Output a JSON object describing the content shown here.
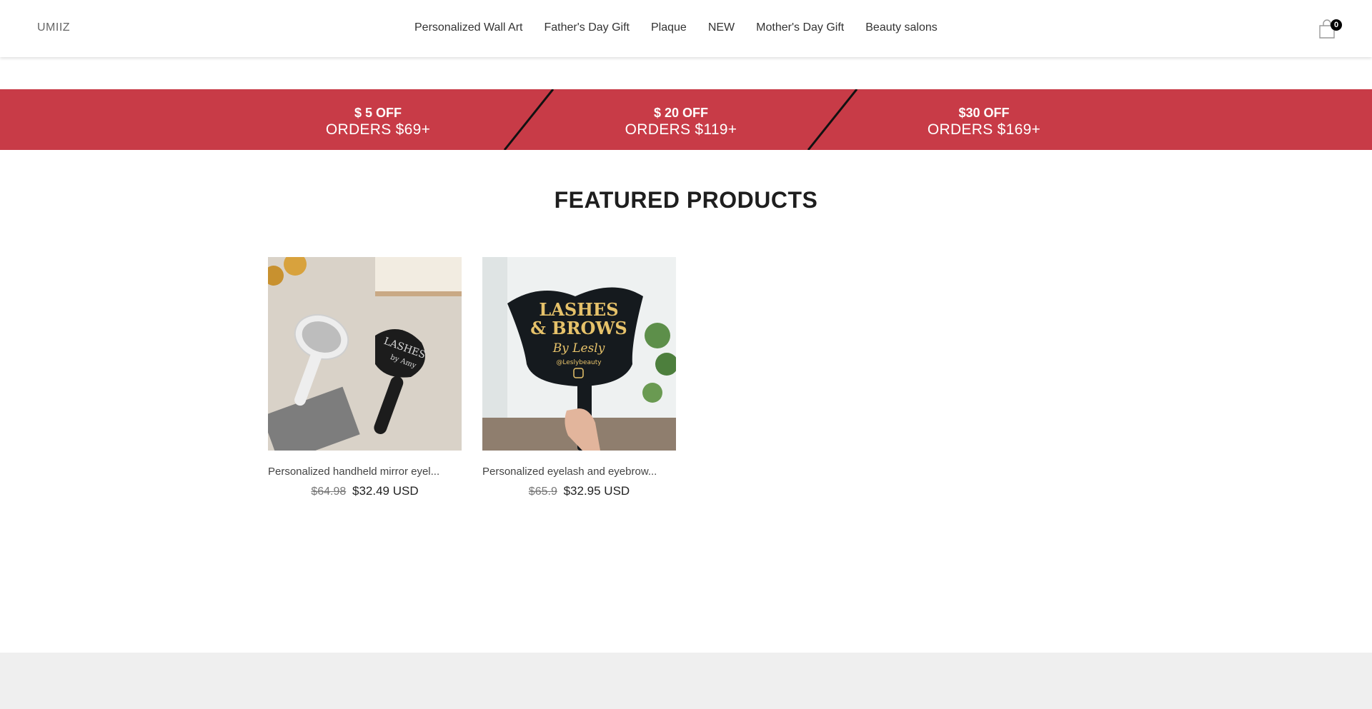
{
  "header": {
    "logo": "UMIIZ",
    "nav": [
      {
        "label": "Personalized Wall Art"
      },
      {
        "label": "Father's Day Gift"
      },
      {
        "label": "Plaque"
      },
      {
        "label": "NEW"
      },
      {
        "label": "Mother's Day Gift"
      },
      {
        "label": "Beauty salons"
      }
    ],
    "cart_count": "0",
    "cart_icon": "shopping-bag-icon"
  },
  "promo": {
    "color": "#c83b47",
    "items": [
      {
        "line1": "$ 5 OFF",
        "line2": "ORDERS $69+"
      },
      {
        "line1": "$ 20 OFF",
        "line2": "ORDERS $119+"
      },
      {
        "line1": "$30 OFF",
        "line2": "ORDERS $169+"
      }
    ]
  },
  "featured": {
    "title": "FEATURED PRODUCTS",
    "products": [
      {
        "name": "Personalized handheld mirror eyel...",
        "old_price": "$64.98",
        "price": "$32.49 USD",
        "image_text": [
          "LASHES",
          "by Amy"
        ]
      },
      {
        "name": "Personalized eyelash and eyebrow...",
        "old_price": "$65.9",
        "price": "$32.95 USD",
        "image_text": [
          "LASHES",
          "& BROWS",
          "By Lesly",
          "@Leslybeauty"
        ]
      }
    ]
  }
}
